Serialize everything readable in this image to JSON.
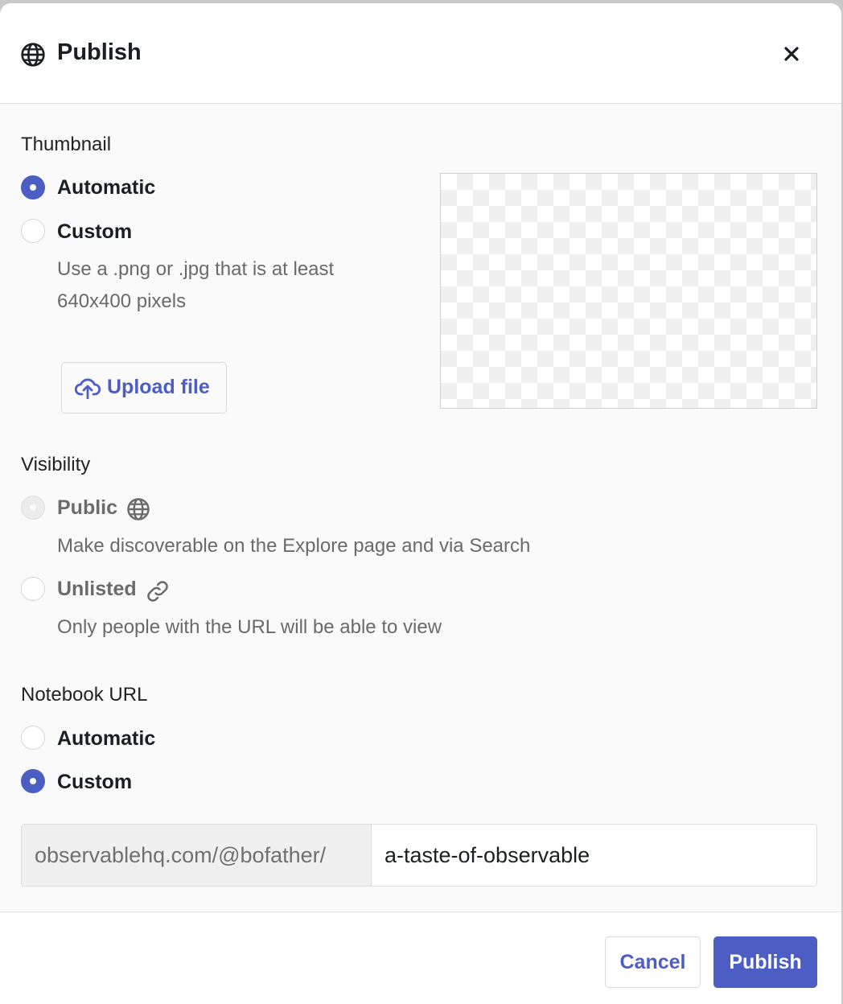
{
  "dialog": {
    "title": "Publish",
    "title_icon": "globe-icon",
    "close_icon": "close-icon"
  },
  "thumbnail": {
    "label": "Thumbnail",
    "options": [
      {
        "label": "Automatic",
        "checked": true
      },
      {
        "label": "Custom",
        "checked": false
      }
    ],
    "help_line1": "Use a .png or .jpg that is at least",
    "help_line2": "640x400 pixels",
    "upload_label": "Upload file",
    "upload_icon": "cloud-upload-icon"
  },
  "visibility": {
    "label": "Visibility",
    "public": {
      "label": "Public",
      "icon": "globe-icon",
      "help": "Make discoverable on the Explore page and via Search",
      "disabled": true
    },
    "unlisted": {
      "label": "Unlisted",
      "icon": "link-icon",
      "help": "Only people with the URL will be able to view",
      "checked": false
    }
  },
  "notebook_url": {
    "label": "Notebook URL",
    "options": [
      {
        "label": "Automatic",
        "checked": false
      },
      {
        "label": "Custom",
        "checked": true
      }
    ],
    "prefix": "observablehq.com/@bofather/",
    "value": "a-taste-of-observable"
  },
  "footer": {
    "cancel_label": "Cancel",
    "publish_label": "Publish"
  },
  "colors": {
    "accent": "#4c5ec3",
    "background": "#fafafa"
  }
}
